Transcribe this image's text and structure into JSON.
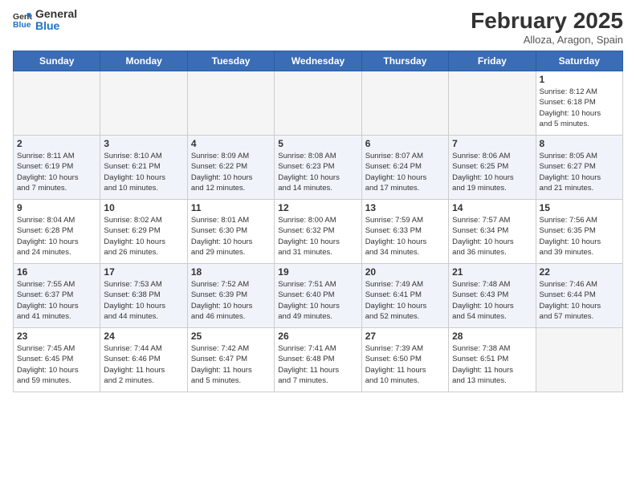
{
  "logo": {
    "line1": "General",
    "line2": "Blue"
  },
  "title": "February 2025",
  "subtitle": "Alloza, Aragon, Spain",
  "headers": [
    "Sunday",
    "Monday",
    "Tuesday",
    "Wednesday",
    "Thursday",
    "Friday",
    "Saturday"
  ],
  "weeks": [
    [
      {
        "day": "",
        "info": ""
      },
      {
        "day": "",
        "info": ""
      },
      {
        "day": "",
        "info": ""
      },
      {
        "day": "",
        "info": ""
      },
      {
        "day": "",
        "info": ""
      },
      {
        "day": "",
        "info": ""
      },
      {
        "day": "1",
        "info": "Sunrise: 8:12 AM\nSunset: 6:18 PM\nDaylight: 10 hours\nand 5 minutes."
      }
    ],
    [
      {
        "day": "2",
        "info": "Sunrise: 8:11 AM\nSunset: 6:19 PM\nDaylight: 10 hours\nand 7 minutes."
      },
      {
        "day": "3",
        "info": "Sunrise: 8:10 AM\nSunset: 6:21 PM\nDaylight: 10 hours\nand 10 minutes."
      },
      {
        "day": "4",
        "info": "Sunrise: 8:09 AM\nSunset: 6:22 PM\nDaylight: 10 hours\nand 12 minutes."
      },
      {
        "day": "5",
        "info": "Sunrise: 8:08 AM\nSunset: 6:23 PM\nDaylight: 10 hours\nand 14 minutes."
      },
      {
        "day": "6",
        "info": "Sunrise: 8:07 AM\nSunset: 6:24 PM\nDaylight: 10 hours\nand 17 minutes."
      },
      {
        "day": "7",
        "info": "Sunrise: 8:06 AM\nSunset: 6:25 PM\nDaylight: 10 hours\nand 19 minutes."
      },
      {
        "day": "8",
        "info": "Sunrise: 8:05 AM\nSunset: 6:27 PM\nDaylight: 10 hours\nand 21 minutes."
      }
    ],
    [
      {
        "day": "9",
        "info": "Sunrise: 8:04 AM\nSunset: 6:28 PM\nDaylight: 10 hours\nand 24 minutes."
      },
      {
        "day": "10",
        "info": "Sunrise: 8:02 AM\nSunset: 6:29 PM\nDaylight: 10 hours\nand 26 minutes."
      },
      {
        "day": "11",
        "info": "Sunrise: 8:01 AM\nSunset: 6:30 PM\nDaylight: 10 hours\nand 29 minutes."
      },
      {
        "day": "12",
        "info": "Sunrise: 8:00 AM\nSunset: 6:32 PM\nDaylight: 10 hours\nand 31 minutes."
      },
      {
        "day": "13",
        "info": "Sunrise: 7:59 AM\nSunset: 6:33 PM\nDaylight: 10 hours\nand 34 minutes."
      },
      {
        "day": "14",
        "info": "Sunrise: 7:57 AM\nSunset: 6:34 PM\nDaylight: 10 hours\nand 36 minutes."
      },
      {
        "day": "15",
        "info": "Sunrise: 7:56 AM\nSunset: 6:35 PM\nDaylight: 10 hours\nand 39 minutes."
      }
    ],
    [
      {
        "day": "16",
        "info": "Sunrise: 7:55 AM\nSunset: 6:37 PM\nDaylight: 10 hours\nand 41 minutes."
      },
      {
        "day": "17",
        "info": "Sunrise: 7:53 AM\nSunset: 6:38 PM\nDaylight: 10 hours\nand 44 minutes."
      },
      {
        "day": "18",
        "info": "Sunrise: 7:52 AM\nSunset: 6:39 PM\nDaylight: 10 hours\nand 46 minutes."
      },
      {
        "day": "19",
        "info": "Sunrise: 7:51 AM\nSunset: 6:40 PM\nDaylight: 10 hours\nand 49 minutes."
      },
      {
        "day": "20",
        "info": "Sunrise: 7:49 AM\nSunset: 6:41 PM\nDaylight: 10 hours\nand 52 minutes."
      },
      {
        "day": "21",
        "info": "Sunrise: 7:48 AM\nSunset: 6:43 PM\nDaylight: 10 hours\nand 54 minutes."
      },
      {
        "day": "22",
        "info": "Sunrise: 7:46 AM\nSunset: 6:44 PM\nDaylight: 10 hours\nand 57 minutes."
      }
    ],
    [
      {
        "day": "23",
        "info": "Sunrise: 7:45 AM\nSunset: 6:45 PM\nDaylight: 10 hours\nand 59 minutes."
      },
      {
        "day": "24",
        "info": "Sunrise: 7:44 AM\nSunset: 6:46 PM\nDaylight: 11 hours\nand 2 minutes."
      },
      {
        "day": "25",
        "info": "Sunrise: 7:42 AM\nSunset: 6:47 PM\nDaylight: 11 hours\nand 5 minutes."
      },
      {
        "day": "26",
        "info": "Sunrise: 7:41 AM\nSunset: 6:48 PM\nDaylight: 11 hours\nand 7 minutes."
      },
      {
        "day": "27",
        "info": "Sunrise: 7:39 AM\nSunset: 6:50 PM\nDaylight: 11 hours\nand 10 minutes."
      },
      {
        "day": "28",
        "info": "Sunrise: 7:38 AM\nSunset: 6:51 PM\nDaylight: 11 hours\nand 13 minutes."
      },
      {
        "day": "",
        "info": ""
      }
    ]
  ]
}
